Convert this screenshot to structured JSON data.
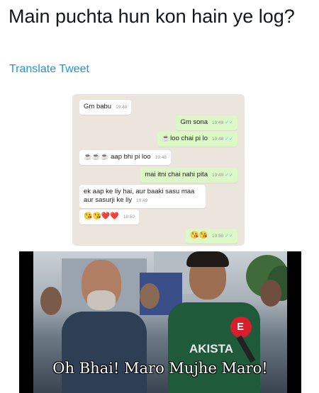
{
  "tweet": {
    "text": "Main puchta hun kon hain ye log?",
    "translate_label": "Translate Tweet"
  },
  "chat": {
    "messages": [
      {
        "side": "in",
        "text": "Gm babu",
        "time": "19:48"
      },
      {
        "side": "out",
        "text": "Gm sona",
        "time": "19:48"
      },
      {
        "side": "out",
        "text": "☕loo chai pi lo",
        "time": "19:48"
      },
      {
        "side": "in",
        "text": "☕☕☕ aap bhi pi loo",
        "time": "19:48"
      },
      {
        "side": "out",
        "text": "mai itni chai nahi pita",
        "time": "19:49"
      },
      {
        "side": "in",
        "text": "ek aap ke liy hai, aur baaki sasu maa aur sasurji ke liy",
        "time": "19:49"
      },
      {
        "side": "in",
        "text": "😘😘❤️❤️",
        "time": "19:50"
      },
      {
        "side": "out",
        "text": "😘😘",
        "time": "19:50"
      }
    ]
  },
  "meme": {
    "caption": "Oh Bhai! Maro Mujhe Maro!",
    "jersey_text": "AKISTA",
    "mic_letter": "E"
  }
}
